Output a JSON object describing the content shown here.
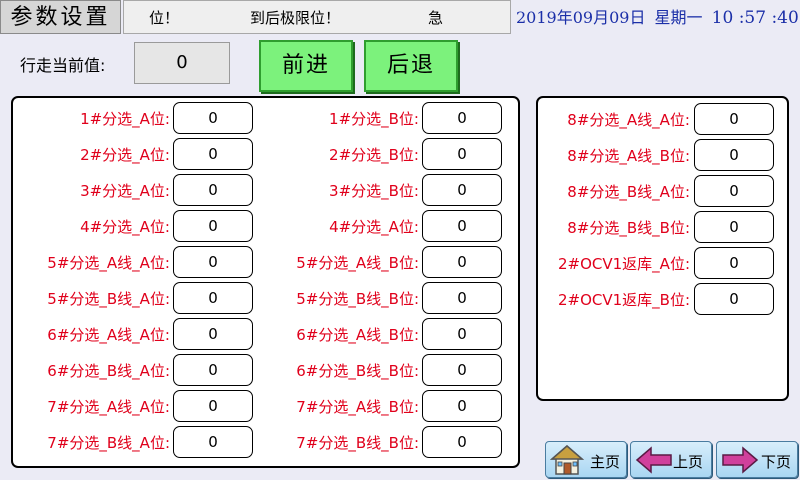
{
  "header": {
    "title": "参数设置",
    "marquee": [
      "位！",
      "到后极限位！",
      "急"
    ],
    "clock": {
      "date": "2019年09月09日",
      "weekday": "星期一",
      "time": "10 :57 :40"
    }
  },
  "travel": {
    "label": "行走当前值:",
    "value": "0"
  },
  "buttons": {
    "forward": "前进",
    "backward": "后退"
  },
  "left_panel": {
    "col1": [
      {
        "label": "1#分选_A位:",
        "value": "0"
      },
      {
        "label": "2#分选_A位:",
        "value": "0"
      },
      {
        "label": "3#分选_A位:",
        "value": "0"
      },
      {
        "label": "4#分选_A位:",
        "value": "0"
      },
      {
        "label": "5#分选_A线_A位:",
        "value": "0"
      },
      {
        "label": "5#分选_B线_A位:",
        "value": "0"
      },
      {
        "label": "6#分选_A线_A位:",
        "value": "0"
      },
      {
        "label": "6#分选_B线_A位:",
        "value": "0"
      },
      {
        "label": "7#分选_A线_A位:",
        "value": "0"
      },
      {
        "label": "7#分选_B线_A位:",
        "value": "0"
      }
    ],
    "col2": [
      {
        "label": "1#分选_B位:",
        "value": "0"
      },
      {
        "label": "2#分选_B位:",
        "value": "0"
      },
      {
        "label": "3#分选_B位:",
        "value": "0"
      },
      {
        "label": "4#分选_A位:",
        "value": "0"
      },
      {
        "label": "5#分选_A线_B位:",
        "value": "0"
      },
      {
        "label": "5#分选_B线_B位:",
        "value": "0"
      },
      {
        "label": "6#分选_A线_B位:",
        "value": "0"
      },
      {
        "label": "6#分选_B线_B位:",
        "value": "0"
      },
      {
        "label": "7#分选_A线_B位:",
        "value": "0"
      },
      {
        "label": "7#分选_B线_B位:",
        "value": "0"
      }
    ]
  },
  "right_panel": [
    {
      "label": "8#分选_A线_A位:",
      "value": "0"
    },
    {
      "label": "8#分选_A线_B位:",
      "value": "0"
    },
    {
      "label": "8#分选_B线_A位:",
      "value": "0"
    },
    {
      "label": "8#分选_B线_B位:",
      "value": "0"
    },
    {
      "label": "2#OCV1返库_A位:",
      "value": "0"
    },
    {
      "label": "2#OCV1返库_B位:",
      "value": "0"
    }
  ],
  "nav": {
    "home": "主页",
    "prev": "上页",
    "next": "下页"
  },
  "colors": {
    "label_red": "#e0001b",
    "button_green": "#7cf27c",
    "clock_blue": "#1b2fa8"
  },
  "icons": {
    "home": "house-icon",
    "prev": "arrow-left-icon",
    "next": "arrow-right-icon"
  }
}
